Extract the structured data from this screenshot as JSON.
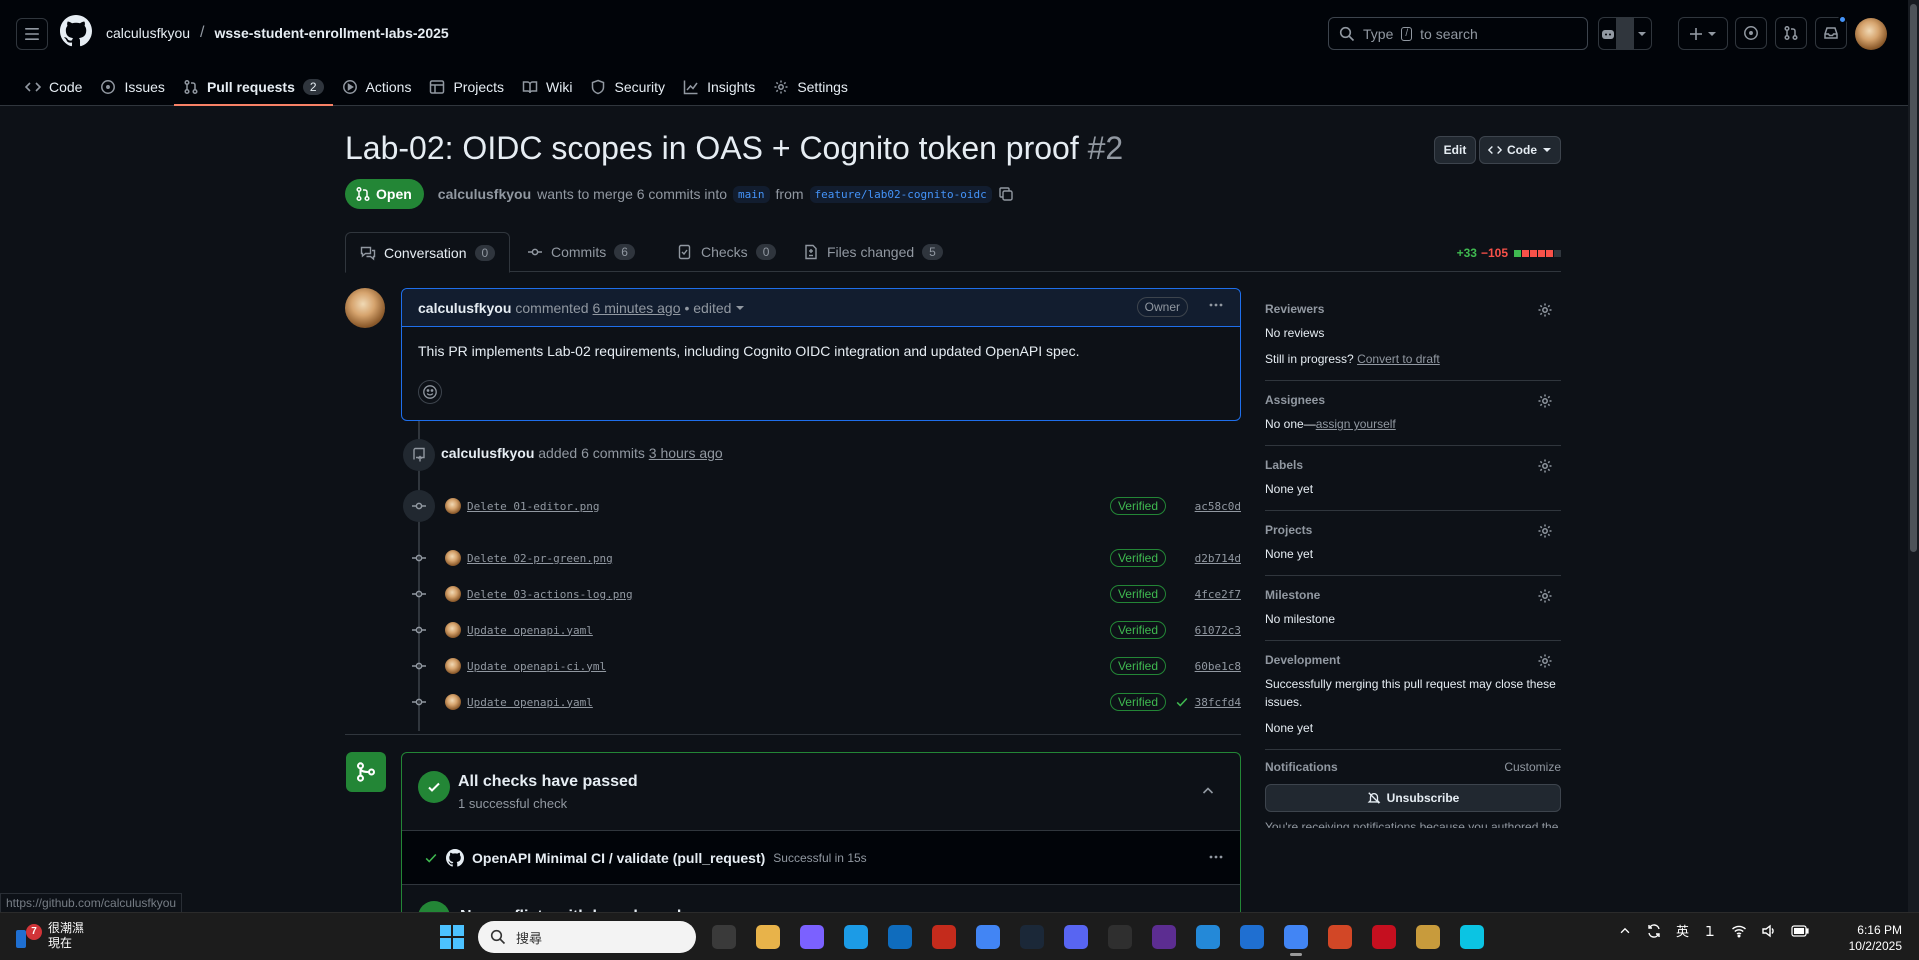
{
  "header": {
    "owner": "calculusfkyou",
    "repo": "wsse-student-enrollment-labs-2025",
    "search_placeholder": "Type",
    "search_key": "/",
    "search_suffix": "to search"
  },
  "nav": [
    {
      "label": "Code",
      "icon": "code-icon"
    },
    {
      "label": "Issues",
      "icon": "issue-icon"
    },
    {
      "label": "Pull requests",
      "icon": "pull-request-icon",
      "count": "2",
      "selected": true
    },
    {
      "label": "Actions",
      "icon": "play-icon"
    },
    {
      "label": "Projects",
      "icon": "table-icon"
    },
    {
      "label": "Wiki",
      "icon": "book-icon"
    },
    {
      "label": "Security",
      "icon": "shield-icon"
    },
    {
      "label": "Insights",
      "icon": "graph-icon"
    },
    {
      "label": "Settings",
      "icon": "gear-icon"
    }
  ],
  "pr": {
    "title": "Lab-02: OIDC scopes in OAS + Cognito token proof",
    "number": "#2",
    "edit_label": "Edit",
    "code_label": "Code",
    "state": "Open",
    "author": "calculusfkyou",
    "merge_text": "wants to merge 6 commits into",
    "base": "main",
    "from_text": "from",
    "head": "feature/lab02-cognito-oidc"
  },
  "tabs": [
    {
      "label": "Conversation",
      "count": "0",
      "icon": "comment-discussion-icon"
    },
    {
      "label": "Commits",
      "count": "6",
      "icon": "commit-icon"
    },
    {
      "label": "Checks",
      "count": "0",
      "icon": "checklist-icon"
    },
    {
      "label": "Files changed",
      "count": "5",
      "icon": "file-diff-icon"
    }
  ],
  "diffstat": {
    "additions": "+33",
    "deletions": "−105",
    "colors": [
      "#3fb950",
      "#f85149",
      "#f85149",
      "#f85149",
      "#f85149",
      "#30363d"
    ]
  },
  "comment": {
    "author": "calculusfkyou",
    "action": "commented",
    "time": "6 minutes ago",
    "edited": "• edited",
    "role": "Owner",
    "body": "This PR implements Lab-02 requirements, including Cognito OIDC integration and updated OpenAPI spec."
  },
  "push": {
    "author": "calculusfkyou",
    "text": "added 6 commits",
    "time": "3 hours ago"
  },
  "commits": [
    {
      "message": "Delete 01-editor.png",
      "verified": "Verified",
      "sha": "ac58c0d"
    },
    {
      "message": "Delete 02-pr-green.png",
      "verified": "Verified",
      "sha": "d2b714d"
    },
    {
      "message": "Delete 03-actions-log.png",
      "verified": "Verified",
      "sha": "4fce2f7"
    },
    {
      "message": "Update openapi.yaml",
      "verified": "Verified",
      "sha": "61072c3"
    },
    {
      "message": "Update openapi-ci.yml",
      "verified": "Verified",
      "sha": "60be1c8"
    },
    {
      "message": "Update openapi.yaml",
      "verified": "Verified",
      "sha": "38fcfd4"
    }
  ],
  "checks": {
    "title": "All checks have passed",
    "subtitle": "1 successful check",
    "row_name": "OpenAPI Minimal CI / validate (pull_request)",
    "row_status": "Successful in 15s",
    "no_conflicts": "No conflicts with base branch"
  },
  "sidebar": {
    "reviewers": {
      "heading": "Reviewers",
      "value": "No reviews",
      "progress": "Still in progress?",
      "draft_link": "Convert to draft"
    },
    "assignees": {
      "heading": "Assignees",
      "value": "No one—",
      "link": "assign yourself"
    },
    "labels": {
      "heading": "Labels",
      "value": "None yet"
    },
    "projects": {
      "heading": "Projects",
      "value": "None yet"
    },
    "milestone": {
      "heading": "Milestone",
      "value": "No milestone"
    },
    "development": {
      "heading": "Development",
      "desc": "Successfully merging this pull request may close these issues.",
      "value": "None yet"
    },
    "notifications": {
      "heading": "Notifications",
      "customize": "Customize",
      "unsubscribe": "Unsubscribe",
      "note": "You're receiving notifications because you authored the thread."
    }
  },
  "status_url": "https://github.com/calculusfkyou",
  "taskbar": {
    "weather_badge": "7",
    "weather_line1": "很潮濕",
    "weather_line2": "現在",
    "search_placeholder": "搜尋",
    "app_colors": [
      "#3a3a3a",
      "#e8b34a",
      "#7b61ff",
      "#1c9be6",
      "#0f6cbd",
      "#c42b1c",
      "#4285f4",
      "#1b2838",
      "#5865f2",
      "#2f2f2f",
      "#5c2d91",
      "#2489d8",
      "#1f6fd1",
      "#4285f4",
      "#d24726",
      "#c50f1f",
      "#c89b3c",
      "#0bc4e3"
    ],
    "ime": "英",
    "time": "6:16 PM",
    "date": "10/2/2025"
  }
}
